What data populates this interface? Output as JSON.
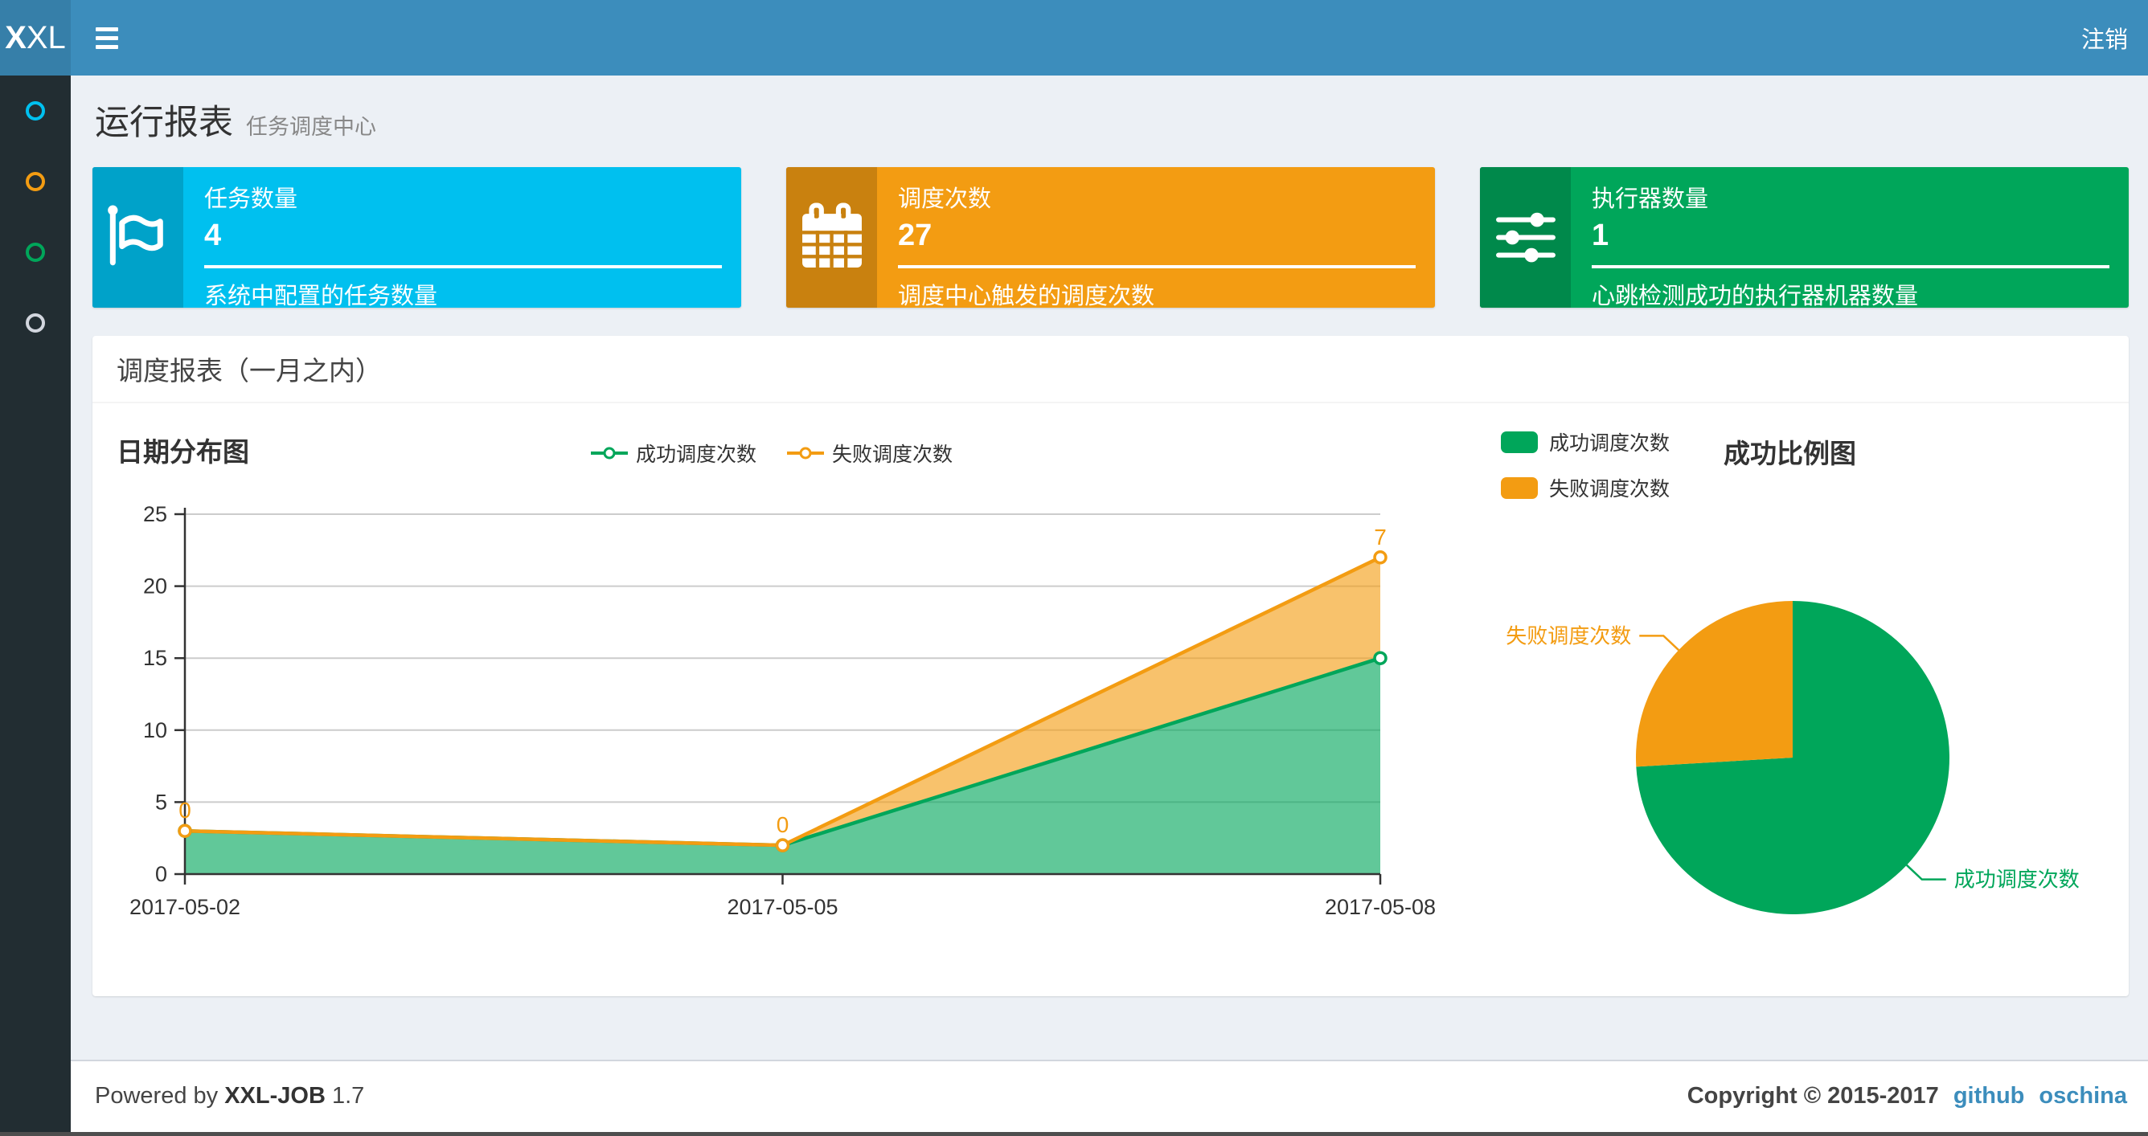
{
  "colors": {
    "navbar_bg": "#3c8dbc",
    "logo_bg": "#367fa9",
    "sidebar_bg": "#222d32",
    "body_bg": "#ecf0f5",
    "link": "#3c8dbc",
    "success_green": "#00a65a",
    "fail_orange": "#f39c12",
    "info_aqua": "#00c0ef"
  },
  "navbar": {
    "logo_bold": "X",
    "logo_light": "XL",
    "logout_label": "注销"
  },
  "sidebar": {
    "items": [
      {
        "icon": "circle-icon",
        "color": "#00c0ef"
      },
      {
        "icon": "circle-icon",
        "color": "#f39c12"
      },
      {
        "icon": "circle-icon",
        "color": "#00a65a"
      },
      {
        "icon": "circle-icon",
        "color": "#d2d6de"
      }
    ]
  },
  "page": {
    "title": "运行报表",
    "subtitle": "任务调度中心"
  },
  "info_boxes": [
    {
      "label": "任务数量",
      "value": "4",
      "description": "系统中配置的任务数量",
      "color": "#00c0ef",
      "icon_bg": "#00a2c9",
      "icon": "flag-icon"
    },
    {
      "label": "调度次数",
      "value": "27",
      "description": "调度中心触发的调度次数",
      "color": "#f39c12",
      "icon_bg": "#c9810f",
      "icon": "calendar-icon"
    },
    {
      "label": "执行器数量",
      "value": "1",
      "description": "心跳检测成功的执行器机器数量",
      "color": "#00a65a",
      "icon_bg": "#00894b",
      "icon": "sliders-icon"
    }
  ],
  "panel": {
    "title": "调度报表（一月之内）"
  },
  "chart_data": [
    {
      "type": "area",
      "title": "日期分布图",
      "categories": [
        "2017-05-02",
        "2017-05-05",
        "2017-05-08"
      ],
      "series": [
        {
          "name": "成功调度次数",
          "values": [
            3,
            2,
            15
          ],
          "color": "#00a65a"
        },
        {
          "name": "失败调度次数",
          "values": [
            0,
            0,
            7
          ],
          "color": "#f39c12"
        }
      ],
      "stacked": true,
      "xlabel": "",
      "ylabel": "",
      "ylim": [
        0,
        25
      ],
      "ytick_step": 5,
      "grid": true,
      "legend_position": "top-center",
      "label_series_index": 1,
      "data_labels_shown": [
        "0",
        "0",
        "7"
      ]
    },
    {
      "type": "pie",
      "title": "成功比例图",
      "series": [
        {
          "name": "成功调度次数",
          "value": 20,
          "color": "#00a65a"
        },
        {
          "name": "失败调度次数",
          "value": 7,
          "color": "#f39c12"
        }
      ],
      "legend_position": "top-left",
      "start_angle_deg": -90
    }
  ],
  "footer": {
    "powered_prefix": "Powered by",
    "brand": "XXL-JOB",
    "version": "1.7",
    "copyright": "Copyright © 2015-2017",
    "links": [
      {
        "label": "github"
      },
      {
        "label": "oschina"
      }
    ]
  }
}
